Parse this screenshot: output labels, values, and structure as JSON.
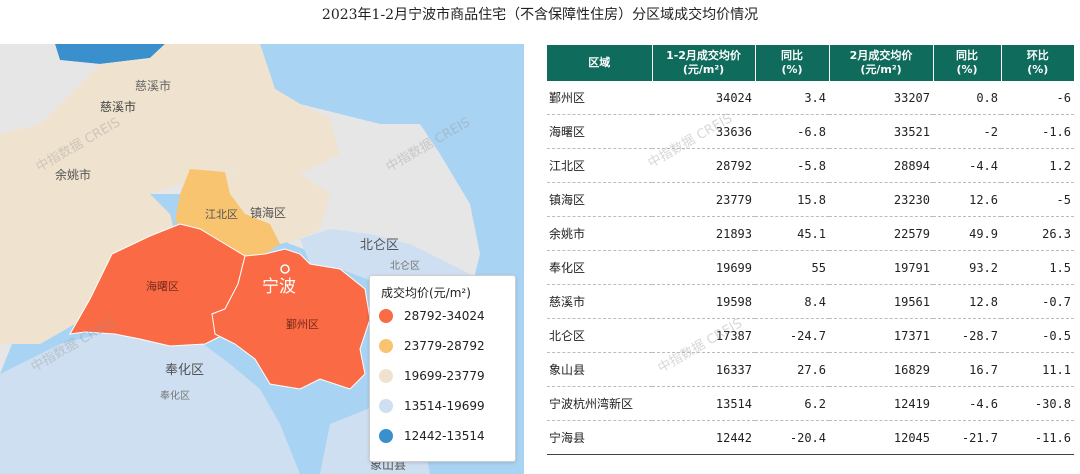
{
  "title": "2023年1-2月宁波市商品住宅（不含保障性住房）分区域成交均价情况",
  "colors": {
    "tier1": "#f96a45",
    "tier2": "#f8c470",
    "tier3": "#efe3cf",
    "tier4": "#cddff0",
    "tier5": "#3a8fcd",
    "header": "#0f6b5c"
  },
  "map": {
    "labels": {
      "cixi": "慈溪市",
      "yuyao": "余姚市",
      "jiangbei": "江北区",
      "zhenhai": "镇海区",
      "haishu": "海曙区",
      "ningbo": "宁波",
      "yinzhou": "鄞州区",
      "beilun": "北仑区",
      "fenghua": "奉化区",
      "xiangshan": "象山县"
    }
  },
  "legend": {
    "title": "成交均价(元/m²)",
    "items": [
      {
        "label": "28792-34024",
        "color": "#f96a45"
      },
      {
        "label": "23779-28792",
        "color": "#f8c470"
      },
      {
        "label": "19699-23779",
        "color": "#efe3cf"
      },
      {
        "label": "13514-19699",
        "color": "#cddff0"
      },
      {
        "label": "12442-13514",
        "color": "#3a8fcd"
      }
    ]
  },
  "watermark": "中指数据 CREIS",
  "chart_data": {
    "type": "table",
    "title": "2023年1-2月宁波市商品住宅（不含保障性住房）分区域成交均价情况",
    "columns": [
      "区域",
      "1-2月成交均价(元/m²)",
      "同比(%)",
      "2月成交均价(元/m²)",
      "同比(%)",
      "环比(%)"
    ],
    "header_lines": [
      [
        "区域"
      ],
      [
        "1-2月成交均价",
        "(元/m²)"
      ],
      [
        "同比",
        "(%)"
      ],
      [
        "2月成交均价",
        "(元/m²)"
      ],
      [
        "同比",
        "(%)"
      ],
      [
        "环比",
        "(%)"
      ]
    ],
    "rows": [
      [
        "鄞州区",
        "34024",
        "3.4",
        "33207",
        "0.8",
        "-6"
      ],
      [
        "海曙区",
        "33636",
        "-6.8",
        "33521",
        "-2",
        "-1.6"
      ],
      [
        "江北区",
        "28792",
        "-5.8",
        "28894",
        "-4.4",
        "1.2"
      ],
      [
        "镇海区",
        "23779",
        "15.8",
        "23230",
        "12.6",
        "-5"
      ],
      [
        "余姚市",
        "21893",
        "45.1",
        "22579",
        "49.9",
        "26.3"
      ],
      [
        "奉化区",
        "19699",
        "55",
        "19791",
        "93.2",
        "1.5"
      ],
      [
        "慈溪市",
        "19598",
        "8.4",
        "19561",
        "12.8",
        "-0.7"
      ],
      [
        "北仑区",
        "17387",
        "-24.7",
        "17371",
        "-28.7",
        "-0.5"
      ],
      [
        "象山县",
        "16337",
        "27.6",
        "16829",
        "16.7",
        "11.1"
      ],
      [
        "宁波杭州湾新区",
        "13514",
        "6.2",
        "12419",
        "-4.6",
        "-30.8"
      ],
      [
        "宁海县",
        "12442",
        "-20.4",
        "12045",
        "-21.7",
        "-11.6"
      ]
    ]
  }
}
